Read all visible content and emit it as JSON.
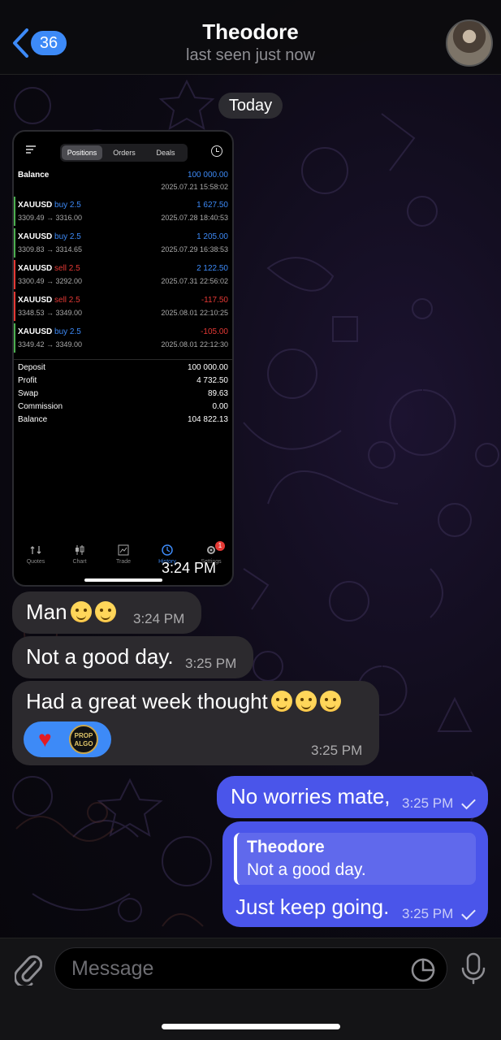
{
  "header": {
    "back_count": "36",
    "title": "Theodore",
    "status": "last seen just now"
  },
  "date_separator": "Today",
  "screenshot": {
    "tabs": [
      "Positions",
      "Orders",
      "Deals"
    ],
    "balance_label": "Balance",
    "balance_value": "100 000.00",
    "balance_time": "2025.07.21 15:58:02",
    "trades": [
      {
        "symbol": "XAUUSD",
        "direction": "buy 2.5",
        "prices": "3309.49 → 3316.00",
        "pnl": "1 627.50",
        "time": "2025.07.28 18:40:53",
        "side": "buy",
        "profit": true
      },
      {
        "symbol": "XAUUSD",
        "direction": "buy 2.5",
        "prices": "3309.83 → 3314.65",
        "pnl": "1 205.00",
        "time": "2025.07.29 16:38:53",
        "side": "buy",
        "profit": true
      },
      {
        "symbol": "XAUUSD",
        "direction": "sell 2.5",
        "prices": "3300.49 → 3292.00",
        "pnl": "2 122.50",
        "time": "2025.07.31 22:56:02",
        "side": "sell",
        "profit": true
      },
      {
        "symbol": "XAUUSD",
        "direction": "sell 2.5",
        "prices": "3348.53 → 3349.00",
        "pnl": "-117.50",
        "time": "2025.08.01 22:10:25",
        "side": "sell",
        "profit": false
      },
      {
        "symbol": "XAUUSD",
        "direction": "buy 2.5",
        "prices": "3349.42 → 3349.00",
        "pnl": "-105.00",
        "time": "2025.08.01 22:12:30",
        "side": "buy",
        "profit": false
      }
    ],
    "summary": [
      {
        "label": "Deposit",
        "value": "100 000.00"
      },
      {
        "label": "Profit",
        "value": "4 732.50"
      },
      {
        "label": "Swap",
        "value": "89.63"
      },
      {
        "label": "Commission",
        "value": "0.00"
      },
      {
        "label": "Balance",
        "value": "104 822.13"
      }
    ],
    "nav": [
      "Quotes",
      "Chart",
      "Trade",
      "History",
      "Settings"
    ],
    "nav_badge": "1",
    "timestamp": "3:24 PM"
  },
  "messages": [
    {
      "text": "Man",
      "time": "3:24 PM"
    },
    {
      "text": "Not a good day.",
      "time": "3:25 PM"
    },
    {
      "text": "Had a great week thought",
      "time": "3:25 PM",
      "reaction_logo": "PROP ALGO"
    },
    {
      "text": "No worries mate,",
      "time": "3:25 PM"
    },
    {
      "reply_name": "Theodore",
      "reply_text": "Not a good day.",
      "text": "Just keep going.",
      "time": "3:25 PM"
    }
  ],
  "input": {
    "placeholder": "Message"
  },
  "colors": {
    "accent": "#3d8af7",
    "outgoing": "#4a55ea",
    "incoming": "#2c2a2e",
    "loss": "#e53935"
  },
  "icons": [
    "back-chevron-icon",
    "paperclip-icon",
    "sticker-icon",
    "microphone-icon",
    "heart-icon"
  ]
}
